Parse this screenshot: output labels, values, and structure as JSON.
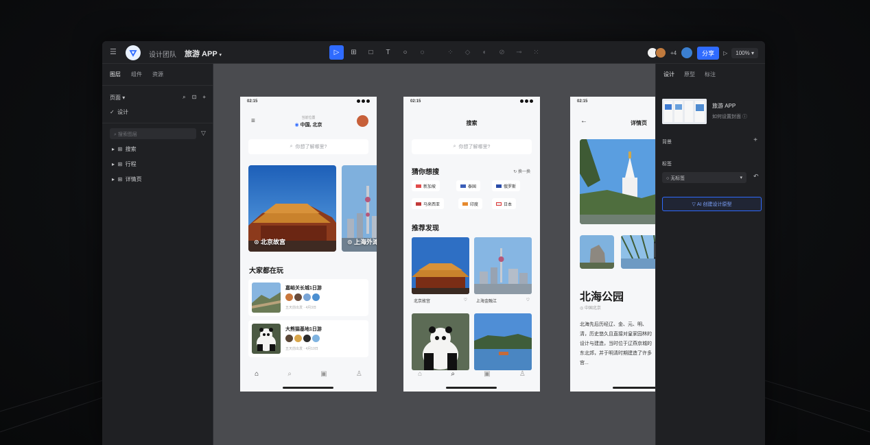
{
  "topbar": {
    "team": "设计团队",
    "project": "旅游 APP",
    "share_label": "分享",
    "zoom": "100%",
    "collaborators_more": "+4",
    "accent": "#2f6bff"
  },
  "left_panel": {
    "tabs": [
      "图层",
      "组件",
      "资源"
    ],
    "pages_label": "页面",
    "pages": [
      "设计"
    ],
    "search_placeholder": "搜索图层",
    "layers": [
      "搜索",
      "行程",
      "详情页"
    ]
  },
  "phone1": {
    "time": "02:15",
    "location_caption": "当前位置",
    "location": "中国, 北京",
    "search_placeholder": "你想了解哪里?",
    "cards": [
      "北京故宫",
      "上海外滩"
    ],
    "section_title": "大家都在玩",
    "trips": [
      {
        "title": "嘉峪关长城1日游",
        "meta": "五天前出发 · 4月3日"
      },
      {
        "title": "大熊猫基地1日游",
        "meta": "五天前出发 · 4月10日"
      }
    ],
    "tabs": [
      "home-icon",
      "search-icon",
      "calendar-icon",
      "user-icon"
    ]
  },
  "phone2": {
    "time": "02:15",
    "title": "搜索",
    "search_placeholder": "你想了解哪里?",
    "guess_title": "猜你想搜",
    "refresh": "换一换",
    "chips": [
      "新加坡",
      "泰国",
      "俄罗斯",
      "马来西亚",
      "印度",
      "日本"
    ],
    "recommend_title": "推荐发现",
    "grid": [
      "北京故宫",
      "上海金融江"
    ]
  },
  "phone3": {
    "time": "02:15",
    "title": "详情页",
    "place": "北海公园",
    "location": "中国北京",
    "description": "北海先后历经辽、金、元、明、清，历史悠久且直接对皇家园林的设计与建造，当时位于辽燕京城的东北郊，并于明清时期建造了许多宫..."
  },
  "right_panel": {
    "tabs": [
      "设计",
      "原型",
      "标注"
    ],
    "file_name": "旅游 APP",
    "file_sub": "如何设置封面",
    "background_label": "背景",
    "frame_label": "标签",
    "frame_value": "无标签",
    "create_button": "AI 创建设计原型"
  }
}
